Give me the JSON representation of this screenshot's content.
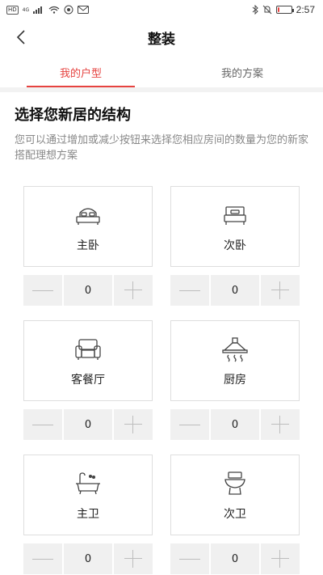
{
  "status_bar": {
    "network_badge": "HD",
    "network_gen": "4G",
    "time": "2:57",
    "battery_level": 0.1
  },
  "header": {
    "title": "整装"
  },
  "tabs": [
    {
      "label": "我的户型",
      "active": true
    },
    {
      "label": "我的方案",
      "active": false
    }
  ],
  "intro": {
    "title": "选择您新居的结构",
    "description": "您可以通过增加或减少按钮来选择您相应房间的数量为您的新家搭配理想方案"
  },
  "rooms": [
    {
      "label": "主卧",
      "icon": "master-bed-icon",
      "count": "0"
    },
    {
      "label": "次卧",
      "icon": "second-bed-icon",
      "count": "0"
    },
    {
      "label": "客餐厅",
      "icon": "sofa-icon",
      "count": "0"
    },
    {
      "label": "厨房",
      "icon": "range-hood-icon",
      "count": "0"
    },
    {
      "label": "主卫",
      "icon": "bathtub-icon",
      "count": "0"
    },
    {
      "label": "次卫",
      "icon": "toilet-icon",
      "count": "0"
    }
  ],
  "colors": {
    "accent": "#e64340",
    "card_border": "#dedede",
    "stepper_bg": "#f0f0f0"
  }
}
